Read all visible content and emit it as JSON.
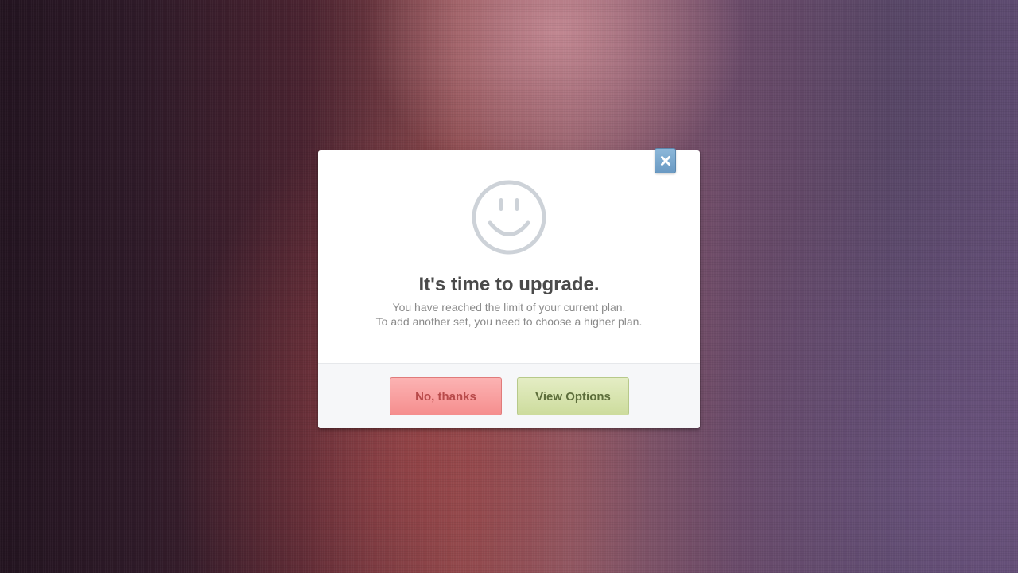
{
  "dialog": {
    "icon": "smiley-icon",
    "title": "It's time to upgrade.",
    "message_line1": "You have reached the limit of your current plan.",
    "message_line2": "To add another set, you need to choose a higher plan.",
    "close_icon": "close-icon",
    "buttons": {
      "no_thanks": "No, thanks",
      "view_options": "View Options"
    }
  },
  "colors": {
    "decline_button": "#f58e8e",
    "confirm_button": "#cddc9d",
    "close_button": "#6a9ac3",
    "title_text": "#4a4a4a",
    "message_text": "#8a8a8a",
    "icon_stroke": "#cdd2d8"
  }
}
